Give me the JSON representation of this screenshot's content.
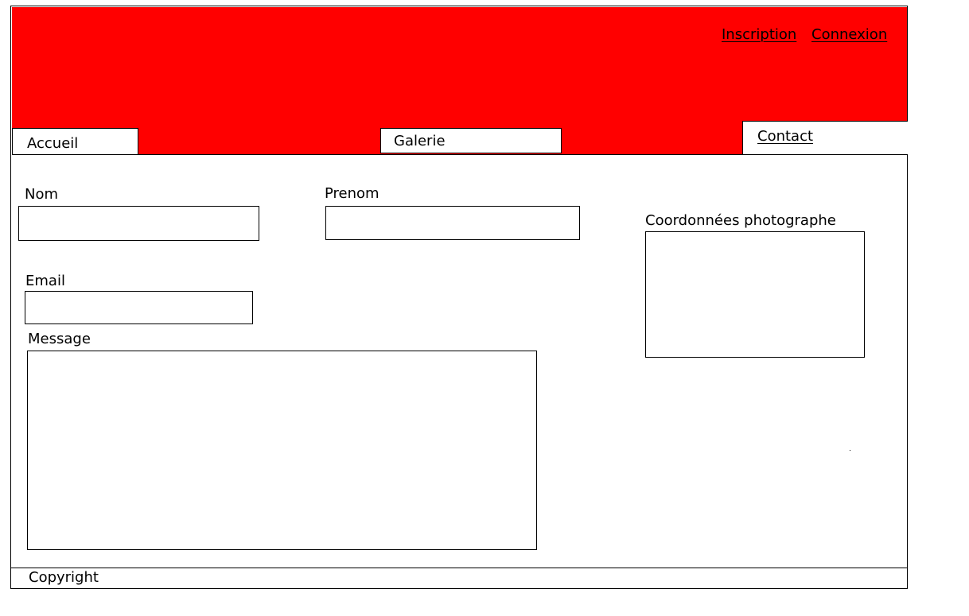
{
  "header": {
    "background_color": "#ff0000",
    "links": {
      "inscription": "Inscription",
      "connexion": "Connexion"
    }
  },
  "nav": {
    "accueil": "Accueil",
    "galerie": "Galerie",
    "contact": "Contact"
  },
  "form": {
    "nom": {
      "label": "Nom",
      "value": ""
    },
    "prenom": {
      "label": "Prenom",
      "value": ""
    },
    "email": {
      "label": "Email",
      "value": ""
    },
    "message": {
      "label": "Message",
      "value": ""
    }
  },
  "sidebar": {
    "coordonnees_label": "Coordonnées photographe"
  },
  "footer": {
    "copyright": "Copyright"
  }
}
